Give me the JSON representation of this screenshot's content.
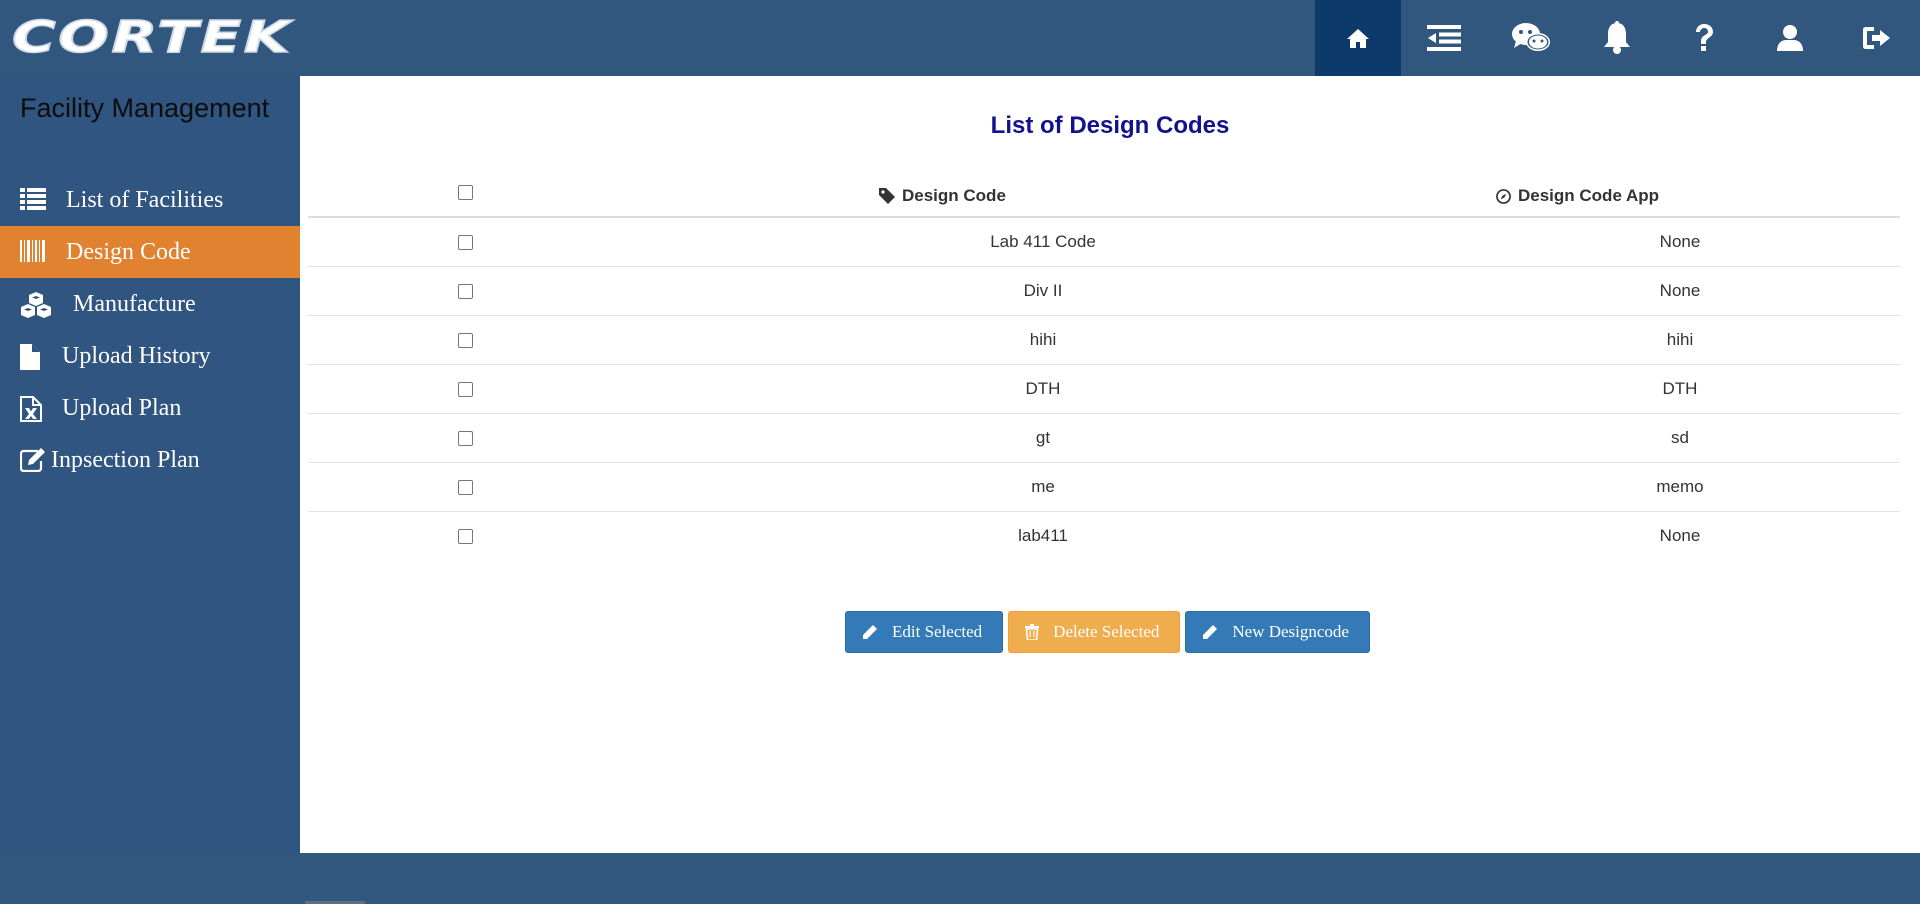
{
  "header": {
    "logo_text": "CORTEK",
    "nav": [
      "home-icon",
      "menu-collapse-icon",
      "wechat-icon",
      "bell-icon",
      "help-icon",
      "user-icon",
      "sign-out-icon"
    ]
  },
  "sidebar": {
    "title": "Facility Management",
    "items": [
      {
        "label": "List of Facilities",
        "icon": "list-icon"
      },
      {
        "label": "Design Code",
        "icon": "barcode-icon",
        "active": true
      },
      {
        "label": "Manufacture",
        "icon": "cubes-icon"
      },
      {
        "label": "Upload History",
        "icon": "file-icon"
      },
      {
        "label": "Upload Plan",
        "icon": "file-excel-icon"
      },
      {
        "label": "Inpsection Plan",
        "icon": "edit-icon"
      }
    ]
  },
  "main": {
    "title": "List of Design Codes",
    "columns": {
      "design_code": "Design Code",
      "design_code_app": "Design Code App"
    },
    "rows": [
      {
        "code": "Lab 411 Code",
        "app": "None"
      },
      {
        "code": "Div II",
        "app": "None"
      },
      {
        "code": "hihi",
        "app": "hihi"
      },
      {
        "code": "DTH",
        "app": "DTH"
      },
      {
        "code": "gt",
        "app": "sd"
      },
      {
        "code": "me",
        "app": "memo"
      },
      {
        "code": "lab411",
        "app": "None"
      }
    ],
    "buttons": {
      "edit": "Edit Selected",
      "delete": "Delete Selected",
      "new": "New Designcode"
    }
  },
  "colors": {
    "header_bg": "#32577f",
    "active_nav": "#0b3a6b",
    "sidebar_active": "#e08230",
    "title": "#12128f",
    "btn_primary": "#337ab7",
    "btn_warning": "#f0ad4e"
  }
}
